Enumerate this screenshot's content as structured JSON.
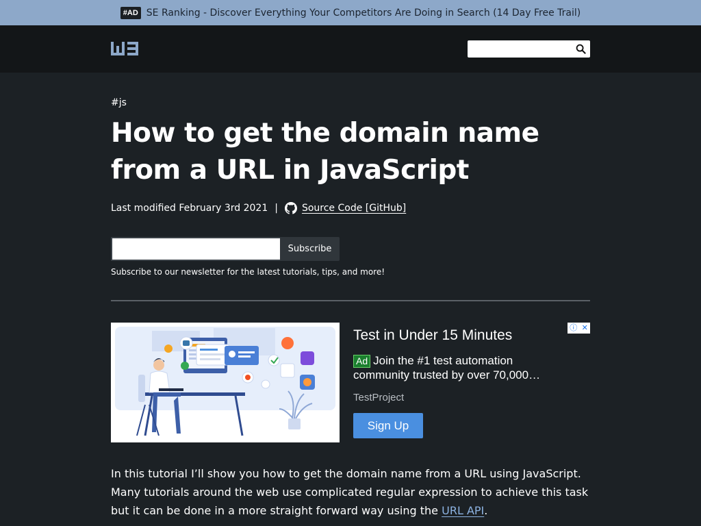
{
  "topbar": {
    "badge": "#AD",
    "text": "SE Ranking - Discover Everything Your Competitors Are Doing in Search (14 Day Free Trail)"
  },
  "header": {
    "logo_text": "W3",
    "search": {
      "value": "",
      "placeholder": "",
      "icon": "search-icon"
    }
  },
  "article": {
    "tag": "#js",
    "title_line1": "How to get the domain name",
    "title_line2": "from a URL in JavaScript",
    "meta_date": "Last modified February 3rd 2021",
    "meta_separator": "|",
    "source_link": "Source Code [GitHub]",
    "intro_before": "In this tutorial I’ll show you how to get the domain name from a URL using JavaScript. Many tutorials around the web use complicated regular expression to achieve this task but it can be done in a more straight forward way using the ",
    "intro_link": "URL API",
    "intro_after": "."
  },
  "newsletter": {
    "input_value": "",
    "button_label": "Subscribe",
    "note": "Subscribe to our newsletter for the latest tutorials, tips, and more!"
  },
  "ad": {
    "title": "Test in Under 15 Minutes",
    "label": "Ad",
    "description": "Join the #1 test automation community trusted by over 70,000…",
    "brand": "TestProject",
    "cta": "Sign Up"
  },
  "colors": {
    "page_bg": "#1c2125",
    "header_bg": "#131618",
    "topbar_bg": "#8da8c9",
    "cta_blue": "#4a8fe0",
    "link_blue": "#8db3e2"
  }
}
